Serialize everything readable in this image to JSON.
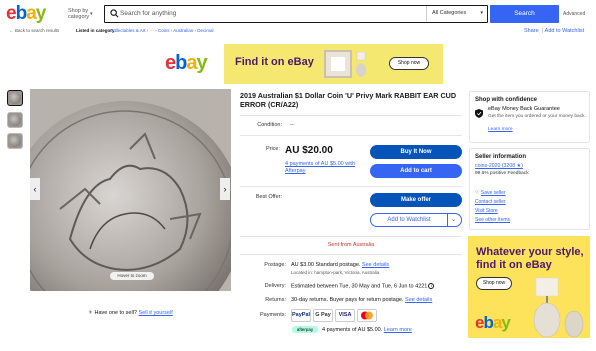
{
  "header": {
    "logo": {
      "e": "e",
      "b": "b",
      "a": "a",
      "y": "y"
    },
    "shop_by": "Shop by category",
    "search_placeholder": "Search for anything",
    "category": "All Categories",
    "search_button": "Search",
    "advanced": "Advanced"
  },
  "crumbs": {
    "back": "Back to search results",
    "listed_in": "Listed in category:",
    "path": "Collectables & Art  ›  ···  ›  Coins  ›  Australian  ›  Decimal",
    "share": "Share",
    "watchlist": "Add to Watchlist"
  },
  "top_ad": {
    "logo": "ebay",
    "headline": "Find it on eBay",
    "cta": "Shop now"
  },
  "listing": {
    "title": "2019 Australian $1 Dollar Coin 'U' Privy Mark RABBIT EAR CUD ERROR (CR/A22)",
    "condition_label": "Condition:",
    "condition_value": "--",
    "price_label": "Price:",
    "price": "AU $20.00",
    "payments_link": "4 payments of AU $5.00 with Afterpay",
    "buy_now": "Buy It Now",
    "add_to_cart": "Add to cart",
    "best_offer_label": "Best Offer:",
    "make_offer": "Make offer",
    "add_watchlist": "Add to Watchlist",
    "sent_from": "Sent from Australia",
    "postage_label": "Postage:",
    "postage_value": "AU $3.00 Standard postage.",
    "postage_link": "See details",
    "located": "Located in: hampton-park, Victoria, Australia",
    "delivery_label": "Delivery:",
    "delivery_value": "Estimated between Tue, 30 May and Tue, 6 Jun to 4221",
    "returns_label": "Returns:",
    "returns_value": "30-day returns. Buyer pays for return postage.",
    "returns_link": "See details",
    "payments_label": "Payments:",
    "pay_cards": [
      "PayPal",
      "G Pay",
      "VISA",
      ""
    ],
    "afterpay_badge": "afterpay",
    "afterpay_line": "4 payments of AU $5.00.",
    "learn_more": "Learn more"
  },
  "image": {
    "hover": "Hover to zoom",
    "have_one": "Have one to sell?",
    "sell_it": "Sell it yourself"
  },
  "shop_conf": {
    "heading": "Shop with confidence",
    "title": "eBay Money Back Guarantee",
    "desc": "Get the item you ordered or your money back.",
    "learn": "Learn more"
  },
  "seller": {
    "heading": "Seller information",
    "name": "coins-2020 (3208 ★)",
    "feedback": "99.6% positive Feedback",
    "save": "Save seller",
    "contact": "Contact seller",
    "store": "Visit Store",
    "other": "See other items"
  },
  "right_ad": {
    "headline": "Whatever your style, find it on eBay",
    "cta": "Shop now",
    "logo": "ebay"
  },
  "colors": {
    "accent": "#3665f3",
    "primary_button": "#0654ba",
    "ad_yellow": "#f5e870",
    "sent_red": "#c0392b"
  }
}
